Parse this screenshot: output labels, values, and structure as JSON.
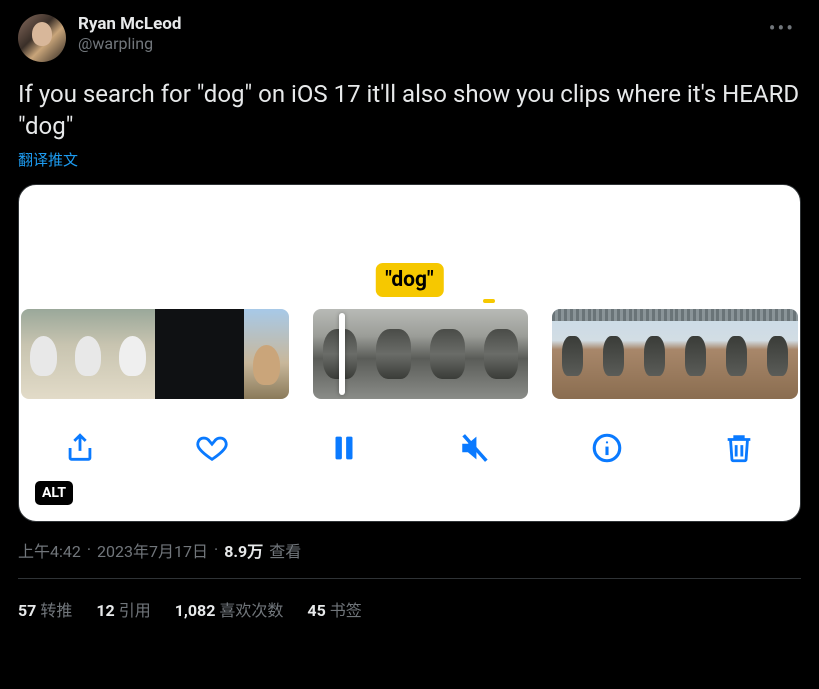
{
  "author": {
    "display_name": "Ryan McLeod",
    "handle": "@warpling"
  },
  "tweet_text": "If you search for \"dog\" on iOS 17 it'll also show you clips where it's HEARD \"dog\"",
  "translate_label": "翻译推文",
  "media": {
    "dog_label": "\"dog\"",
    "alt_badge": "ALT"
  },
  "meta": {
    "time": "上午4:42",
    "date": "2023年7月17日",
    "views_number": "8.9万",
    "views_label": "查看"
  },
  "stats": {
    "retweets_num": "57",
    "retweets_label": "转推",
    "quotes_num": "12",
    "quotes_label": "引用",
    "likes_num": "1,082",
    "likes_label": "喜欢次数",
    "bookmarks_num": "45",
    "bookmarks_label": "书签"
  }
}
